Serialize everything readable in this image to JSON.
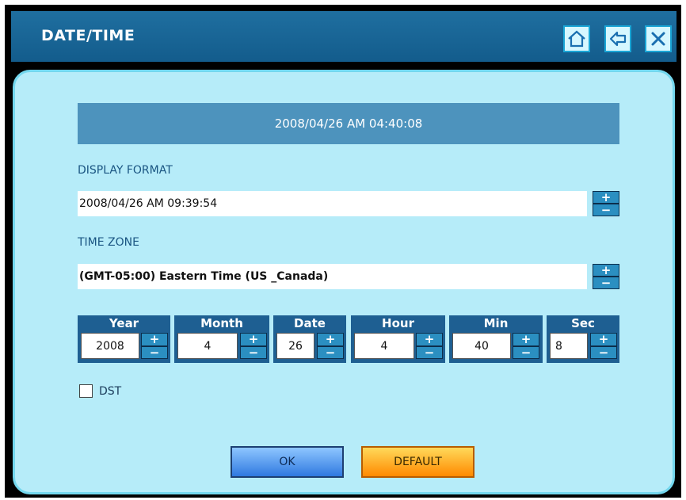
{
  "window": {
    "title": "DATE/TIME"
  },
  "titlebar": {
    "buttons": [
      {
        "name": "home-button",
        "icon": "home-icon"
      },
      {
        "name": "back-button",
        "icon": "back-arrow-icon"
      },
      {
        "name": "close-button",
        "icon": "close-icon"
      }
    ]
  },
  "current_datetime": "2008/04/26 AM 04:40:08",
  "display_format": {
    "label": "DISPLAY FORMAT",
    "value": "2008/04/26 AM 09:39:54",
    "stepper": {
      "plus": "+",
      "minus": "−"
    }
  },
  "time_zone": {
    "label": "TIME ZONE",
    "value": "(GMT-05:00) Eastern Time (US _Canada)",
    "stepper": {
      "plus": "+",
      "minus": "−"
    }
  },
  "fields": [
    {
      "key": "year",
      "label": "Year",
      "value": "2008"
    },
    {
      "key": "month",
      "label": "Month",
      "value": "4"
    },
    {
      "key": "date",
      "label": "Date",
      "value": "26"
    },
    {
      "key": "hour",
      "label": "Hour",
      "value": "4"
    },
    {
      "key": "min",
      "label": "Min",
      "value": "40"
    },
    {
      "key": "sec",
      "label": "Sec",
      "value": "8"
    }
  ],
  "dst": {
    "label": "DST",
    "checked": false
  },
  "buttons": {
    "ok": "OK",
    "default": "DEFAULT"
  },
  "colors": {
    "title_bar": "#135c8c",
    "panel": "#b6ecf9",
    "accent": "#2b8fc1",
    "ok": "#2f79e0",
    "default": "#ff8a00"
  }
}
